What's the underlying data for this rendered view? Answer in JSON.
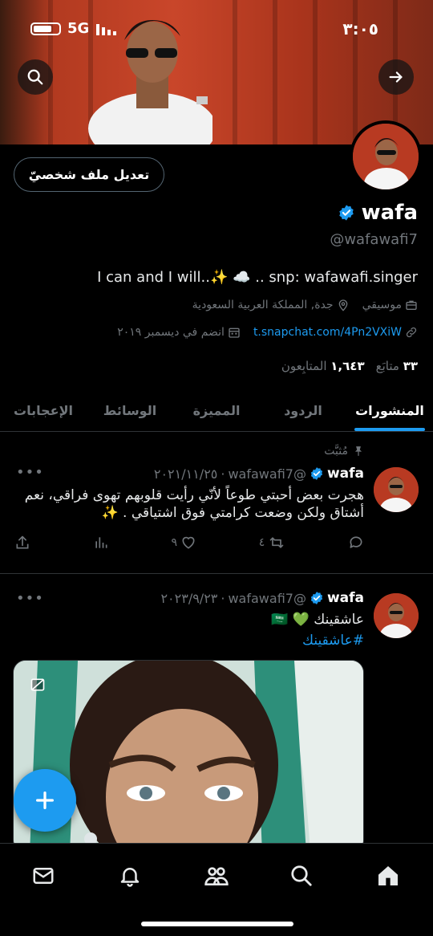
{
  "status_bar": {
    "time": "٣:٠٥",
    "network": "5G"
  },
  "header": {
    "search_icon": "search-icon",
    "forward_icon": "arrow-right-icon"
  },
  "profile": {
    "edit_label": "تعديل ملف شخصيّ",
    "name": "wafa",
    "handle": "@wafawafi7",
    "bio": "I can and I will..✨ ☁️ .. snp: wafawafi.singer",
    "category": "موسيقي",
    "location": "جدة, المملكة العربية السعودية",
    "link": "t.snapchat.com/4Pn2VXiW",
    "joined": "انضم في ديسمبر ٢٠١٩",
    "following_count": "٣٣",
    "following_label": "متابَع",
    "followers_count": "١,٦٤٣",
    "followers_label": "المتابِعون"
  },
  "tabs": [
    {
      "label": "المنشورات"
    },
    {
      "label": "الردود"
    },
    {
      "label": "المميزة"
    },
    {
      "label": "الوسائط"
    },
    {
      "label": "الإعجابات"
    }
  ],
  "tweets": [
    {
      "pinned_label": "مُثبَّت",
      "name": "wafa",
      "handle": "@wafawafi7",
      "date": "٢٠٢١/١١/٢٥",
      "text": "هجرت بعض أحبتي طوعاً لأنّي رأيت قلوبهم تهوى فراقي، نعم أشتاق ولكن وضعت كرامتي فوق اشتياقي . ✨",
      "retweets": "٤",
      "likes": "٩"
    },
    {
      "name": "wafa",
      "handle": "@wafawafi7",
      "date": "٢٠٢٣/٩/٢٣",
      "text": "عاشقينك 💚 🇸🇦",
      "hashtag": "#عاشقينك"
    }
  ],
  "colors": {
    "accent": "#1d9bf0",
    "background": "#000000",
    "muted": "#71767b"
  },
  "bottom_nav": [
    "home-icon",
    "search-icon",
    "communities-icon",
    "notifications-icon",
    "messages-icon"
  ]
}
